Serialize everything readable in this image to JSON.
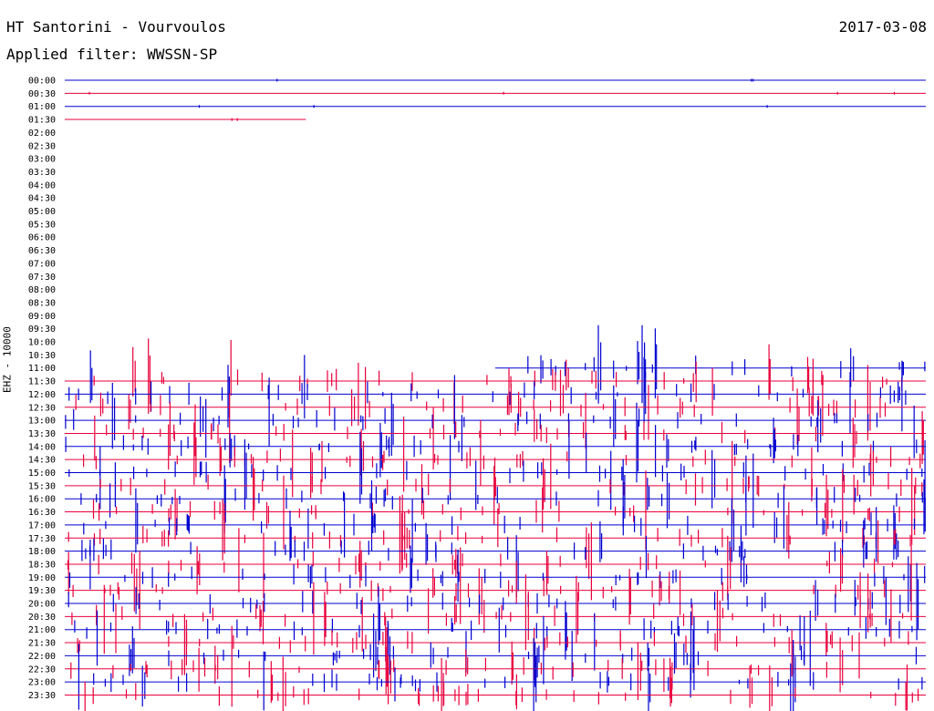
{
  "header": {
    "station": "HT Santorini - Vourvoulos",
    "date": "2017-03-08",
    "filter": "Applied filter: WWSSN-SP"
  },
  "channel": "EHZ - 10000",
  "colors": {
    "trace_even": "#0000d0",
    "trace_odd": "#e8003c"
  },
  "chart_data": {
    "type": "line",
    "subtype": "helicorder",
    "title": "HT Santorini - Vourvoulos",
    "subtitle": "Applied filter: WWSSN-SP",
    "ylabel": "EHZ - 10000",
    "xlabel": "",
    "row_interval_minutes": 30,
    "categories": [
      "00:00",
      "00:30",
      "01:00",
      "01:30",
      "02:00",
      "02:30",
      "03:00",
      "03:30",
      "04:00",
      "04:30",
      "05:00",
      "05:30",
      "06:00",
      "06:30",
      "07:00",
      "07:30",
      "08:00",
      "08:30",
      "09:00",
      "09:30",
      "10:00",
      "10:30",
      "11:00",
      "11:30",
      "12:00",
      "12:30",
      "13:00",
      "13:30",
      "14:00",
      "14:30",
      "15:00",
      "15:30",
      "16:00",
      "16:30",
      "17:00",
      "17:30",
      "18:00",
      "18:30",
      "19:00",
      "19:30",
      "20:00",
      "20:30",
      "21:00",
      "21:30",
      "22:00",
      "22:30",
      "23:00",
      "23:30"
    ],
    "trace_coverage": [
      1,
      1,
      1,
      0.28,
      0,
      0,
      0,
      0,
      0,
      0,
      0,
      0,
      0,
      0,
      0,
      0,
      0,
      0,
      0,
      0,
      0,
      0,
      0.5,
      1,
      1,
      1,
      1,
      1,
      1,
      1,
      1,
      1,
      1,
      1,
      1,
      1,
      1,
      1,
      1,
      1,
      1,
      1,
      1,
      1,
      1,
      1,
      1,
      1
    ],
    "trace_start": [
      0,
      0,
      0,
      0,
      0,
      0,
      0,
      0,
      0,
      0,
      0,
      0,
      0,
      0,
      0,
      0,
      0,
      0,
      0,
      0,
      0,
      0,
      0.5,
      0,
      0,
      0,
      0,
      0,
      0,
      0,
      0,
      0,
      0,
      0,
      0,
      0,
      0,
      0,
      0,
      0,
      0,
      0,
      0,
      0,
      0,
      0,
      0,
      0
    ],
    "activity_level": [
      0.02,
      0.05,
      0.02,
      0.01,
      0,
      0,
      0,
      0,
      0,
      0,
      0,
      0,
      0,
      0,
      0,
      0,
      0,
      0,
      0,
      0,
      0,
      0,
      0.6,
      0.9,
      1,
      1,
      1,
      1,
      1,
      1,
      1,
      1,
      1,
      1,
      1,
      1,
      1,
      1,
      1,
      1,
      1,
      1,
      1,
      1,
      1,
      1,
      1,
      1
    ],
    "grid": false,
    "legend": "none"
  }
}
